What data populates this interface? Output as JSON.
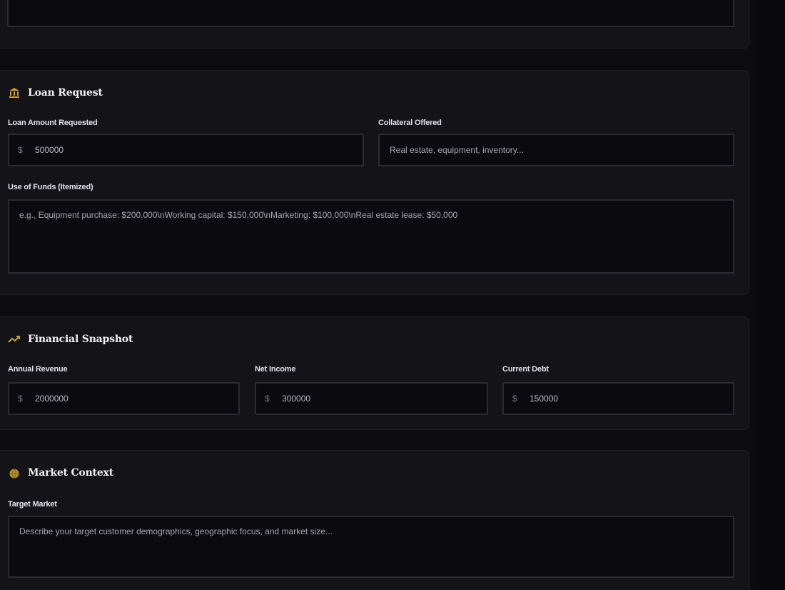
{
  "sections": {
    "loan": {
      "title": "Loan Request",
      "icon": "bank-icon",
      "amount_label": "Loan Amount Requested",
      "amount_prefix": "$",
      "amount_value": "500000",
      "collateral_label": "Collateral Offered",
      "collateral_placeholder": "Real estate, equipment, inventory...",
      "use_label": "Use of Funds (Itemized)",
      "use_placeholder": "e.g., Equipment purchase: $200,000\\nWorking capital: $150,000\\nMarketing: $100,000\\nReal estate lease: $50,000"
    },
    "financial": {
      "title": "Financial Snapshot",
      "icon": "trending-up-icon",
      "revenue_label": "Annual Revenue",
      "revenue_prefix": "$",
      "revenue_value": "2000000",
      "income_label": "Net Income",
      "income_prefix": "$",
      "income_value": "300000",
      "debt_label": "Current Debt",
      "debt_prefix": "$",
      "debt_value": "150000"
    },
    "market": {
      "title": "Market Context",
      "icon": "globe-icon",
      "target_label": "Target Market",
      "target_placeholder": "Describe your target customer demographics, geographic focus, and market size..."
    }
  },
  "colors": {
    "background": "#0c0b0f",
    "card": "#141318",
    "field": "#0b0a0e",
    "border": "#2c2b31",
    "accent_gold": "#c9a227"
  }
}
